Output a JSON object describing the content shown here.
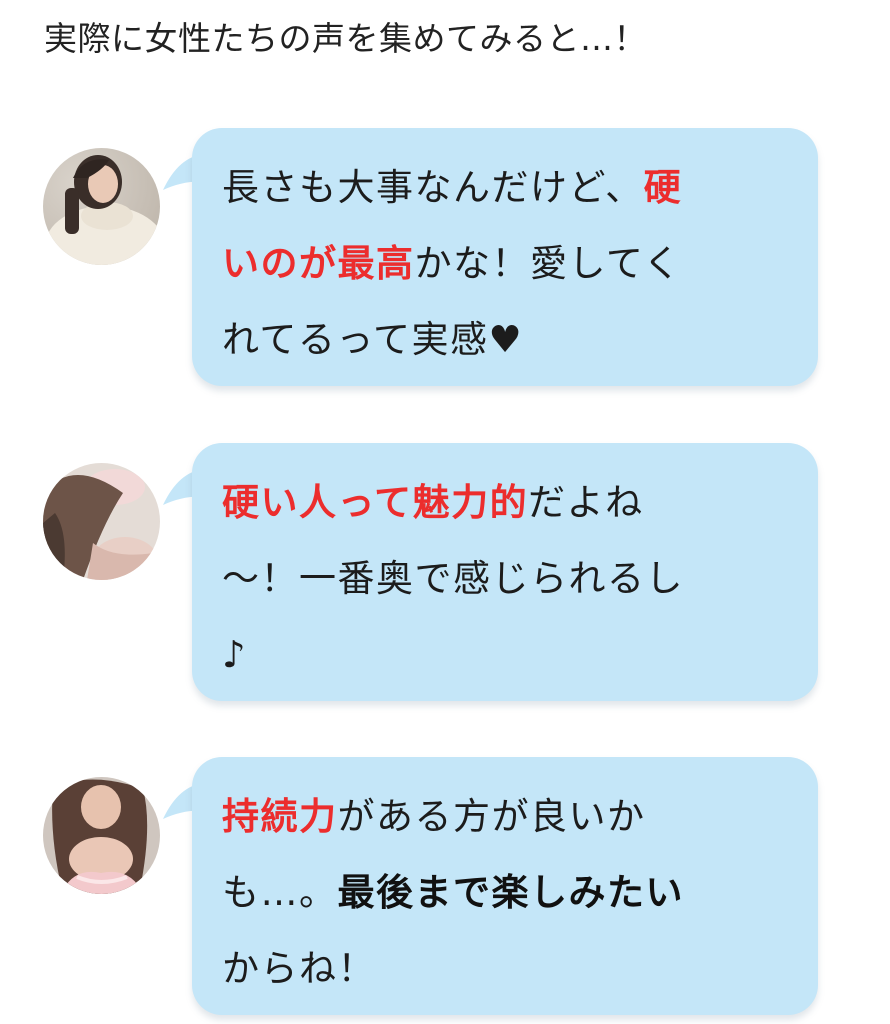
{
  "intro": {
    "text": "実際に女性たちの声を集めてみると…！"
  },
  "colors": {
    "bubble": "#c4e6f8",
    "highlight_red": "#ec2d2d",
    "text": "#1c1c1c"
  },
  "comments": [
    {
      "avatar_icon": "woman-in-white-sweater-photo",
      "lines": [
        [
          {
            "t": "長さも大事なんだけど、"
          },
          {
            "t": "硬",
            "s": "red"
          }
        ],
        [
          {
            "t": "いのが最高",
            "s": "red"
          },
          {
            "t": "かな！愛してく"
          }
        ],
        [
          {
            "t": "れてるって実感♥"
          }
        ]
      ]
    },
    {
      "avatar_icon": "woman-with-wavy-hair-photo",
      "lines": [
        [
          {
            "t": "硬い人って魅力的",
            "s": "red"
          },
          {
            "t": "だよね"
          }
        ],
        [
          {
            "t": "〜！一番奥で感じられるし"
          }
        ],
        [
          {
            "t": "♪"
          }
        ]
      ]
    },
    {
      "avatar_icon": "woman-in-pink-top-photo",
      "lines": [
        [
          {
            "t": "持続力",
            "s": "red"
          },
          {
            "t": "がある方が良いか"
          }
        ],
        [
          {
            "t": "も…。"
          },
          {
            "t": "最後まで楽しみたい",
            "s": "black"
          }
        ],
        [
          {
            "t": "からね！"
          }
        ]
      ]
    }
  ]
}
